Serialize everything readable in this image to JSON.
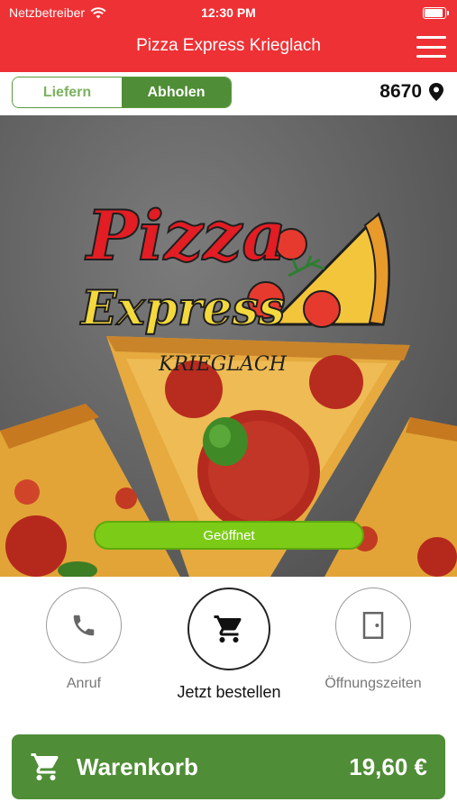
{
  "status_bar": {
    "carrier": "Netzbetreiber",
    "time": "12:30 PM",
    "wifi_icon": "wifi-icon",
    "battery_icon": "battery-icon"
  },
  "header": {
    "title": "Pizza Express Krieglach",
    "menu_icon": "hamburger-menu-icon"
  },
  "mode": {
    "delivery_label": "Liefern",
    "pickup_label": "Abholen",
    "selected": "Abholen",
    "postal_code": "8670",
    "location_icon": "map-pin-icon"
  },
  "logo": {
    "word1": "Pizza",
    "word2": "Express",
    "town": "KRIEGLACH"
  },
  "open_status": "Geöffnet",
  "actions": [
    {
      "label": "Anruf",
      "icon": "phone-icon"
    },
    {
      "label": "Jetzt bestellen",
      "icon": "shopping-cart-icon"
    },
    {
      "label": "Öffnungszeiten",
      "icon": "door-icon"
    }
  ],
  "cart": {
    "label": "Warenkorb",
    "total": "19,60 €",
    "icon": "shopping-cart-icon"
  },
  "colors": {
    "header_red": "#ee3135",
    "brand_green": "#4f8d36",
    "open_green": "#7ccc17"
  }
}
